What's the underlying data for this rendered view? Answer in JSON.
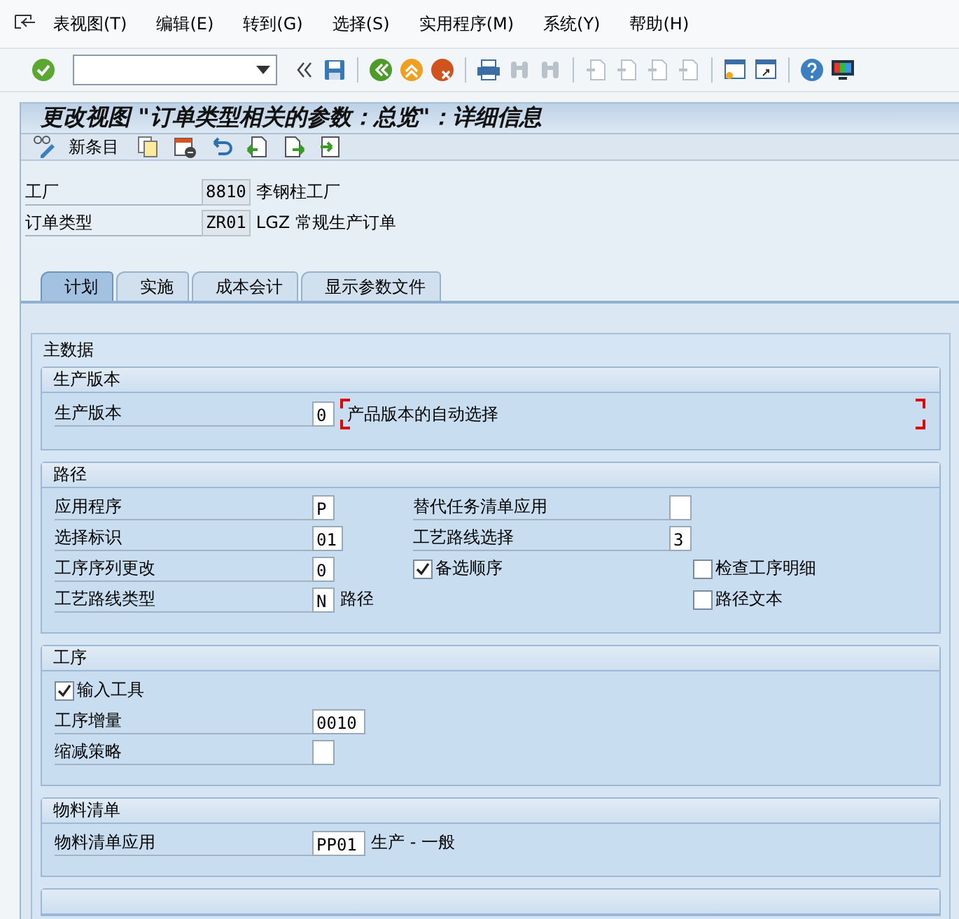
{
  "menu": [
    {
      "label": "表视图(T)"
    },
    {
      "label": "编辑(E)"
    },
    {
      "label": "转到(G)"
    },
    {
      "label": "选择(S)"
    },
    {
      "label": "实用程序(M)"
    },
    {
      "label": "系统(Y)"
    },
    {
      "label": "帮助(H)"
    }
  ],
  "title": "更改视图 \"订单类型相关的参数：总览\"：详细信息",
  "app_toolbar": {
    "new_entries": "新条目"
  },
  "header_fields": [
    {
      "label": "工厂",
      "value": "8810",
      "description": "李钢柱工厂"
    },
    {
      "label": "订单类型",
      "value": "ZR01",
      "description": "LGZ 常规生产订单"
    }
  ],
  "tabs": [
    {
      "label": "计划",
      "selected": true
    },
    {
      "label": "实施",
      "selected": false
    },
    {
      "label": "成本会计",
      "selected": false
    },
    {
      "label": "显示参数文件",
      "selected": false
    }
  ],
  "main_group": {
    "title": "主数据",
    "groups": [
      {
        "title": "生产版本",
        "rows": [
          {
            "left": {
              "kind": "field",
              "label": "生产版本",
              "value": "0",
              "description": "产品版本的自动选择",
              "required": true
            }
          }
        ]
      },
      {
        "title": "路径",
        "rows": [
          {
            "left": {
              "kind": "field",
              "label": "应用程序",
              "value": "P"
            },
            "middle": {
              "kind": "field",
              "label": "替代任务清单应用"
            }
          },
          {
            "left": {
              "kind": "field",
              "label": "选择标识",
              "value": "01"
            },
            "middle": {
              "kind": "field",
              "label": "工艺路线选择",
              "value": "3"
            }
          },
          {
            "left": {
              "kind": "field",
              "label": "工序序列更改",
              "value": "0"
            },
            "middle": {
              "kind": "checkbox",
              "label": "备选顺序",
              "checked": true
            },
            "right": {
              "kind": "checkbox",
              "label": "检查工序明细",
              "checked": false
            }
          },
          {
            "left": {
              "kind": "field",
              "label": "工艺路线类型",
              "value": "N",
              "description": "路径"
            },
            "right": {
              "kind": "checkbox",
              "label": "路径文本",
              "checked": false
            }
          }
        ]
      },
      {
        "title": "工序",
        "rows": [
          {
            "left": {
              "kind": "checkbox",
              "label": "输入工具",
              "checked": true
            }
          },
          {
            "left": {
              "kind": "field",
              "label": "工序增量",
              "value": "0010"
            }
          },
          {
            "left": {
              "kind": "field",
              "label": "缩减策略"
            }
          }
        ]
      },
      {
        "title": "物料清单",
        "rows": [
          {
            "left": {
              "kind": "field",
              "label": "物料清单应用",
              "value": "PP01",
              "description": "生产 - 一般"
            }
          }
        ]
      },
      {
        "kind": "cut_off"
      }
    ]
  }
}
